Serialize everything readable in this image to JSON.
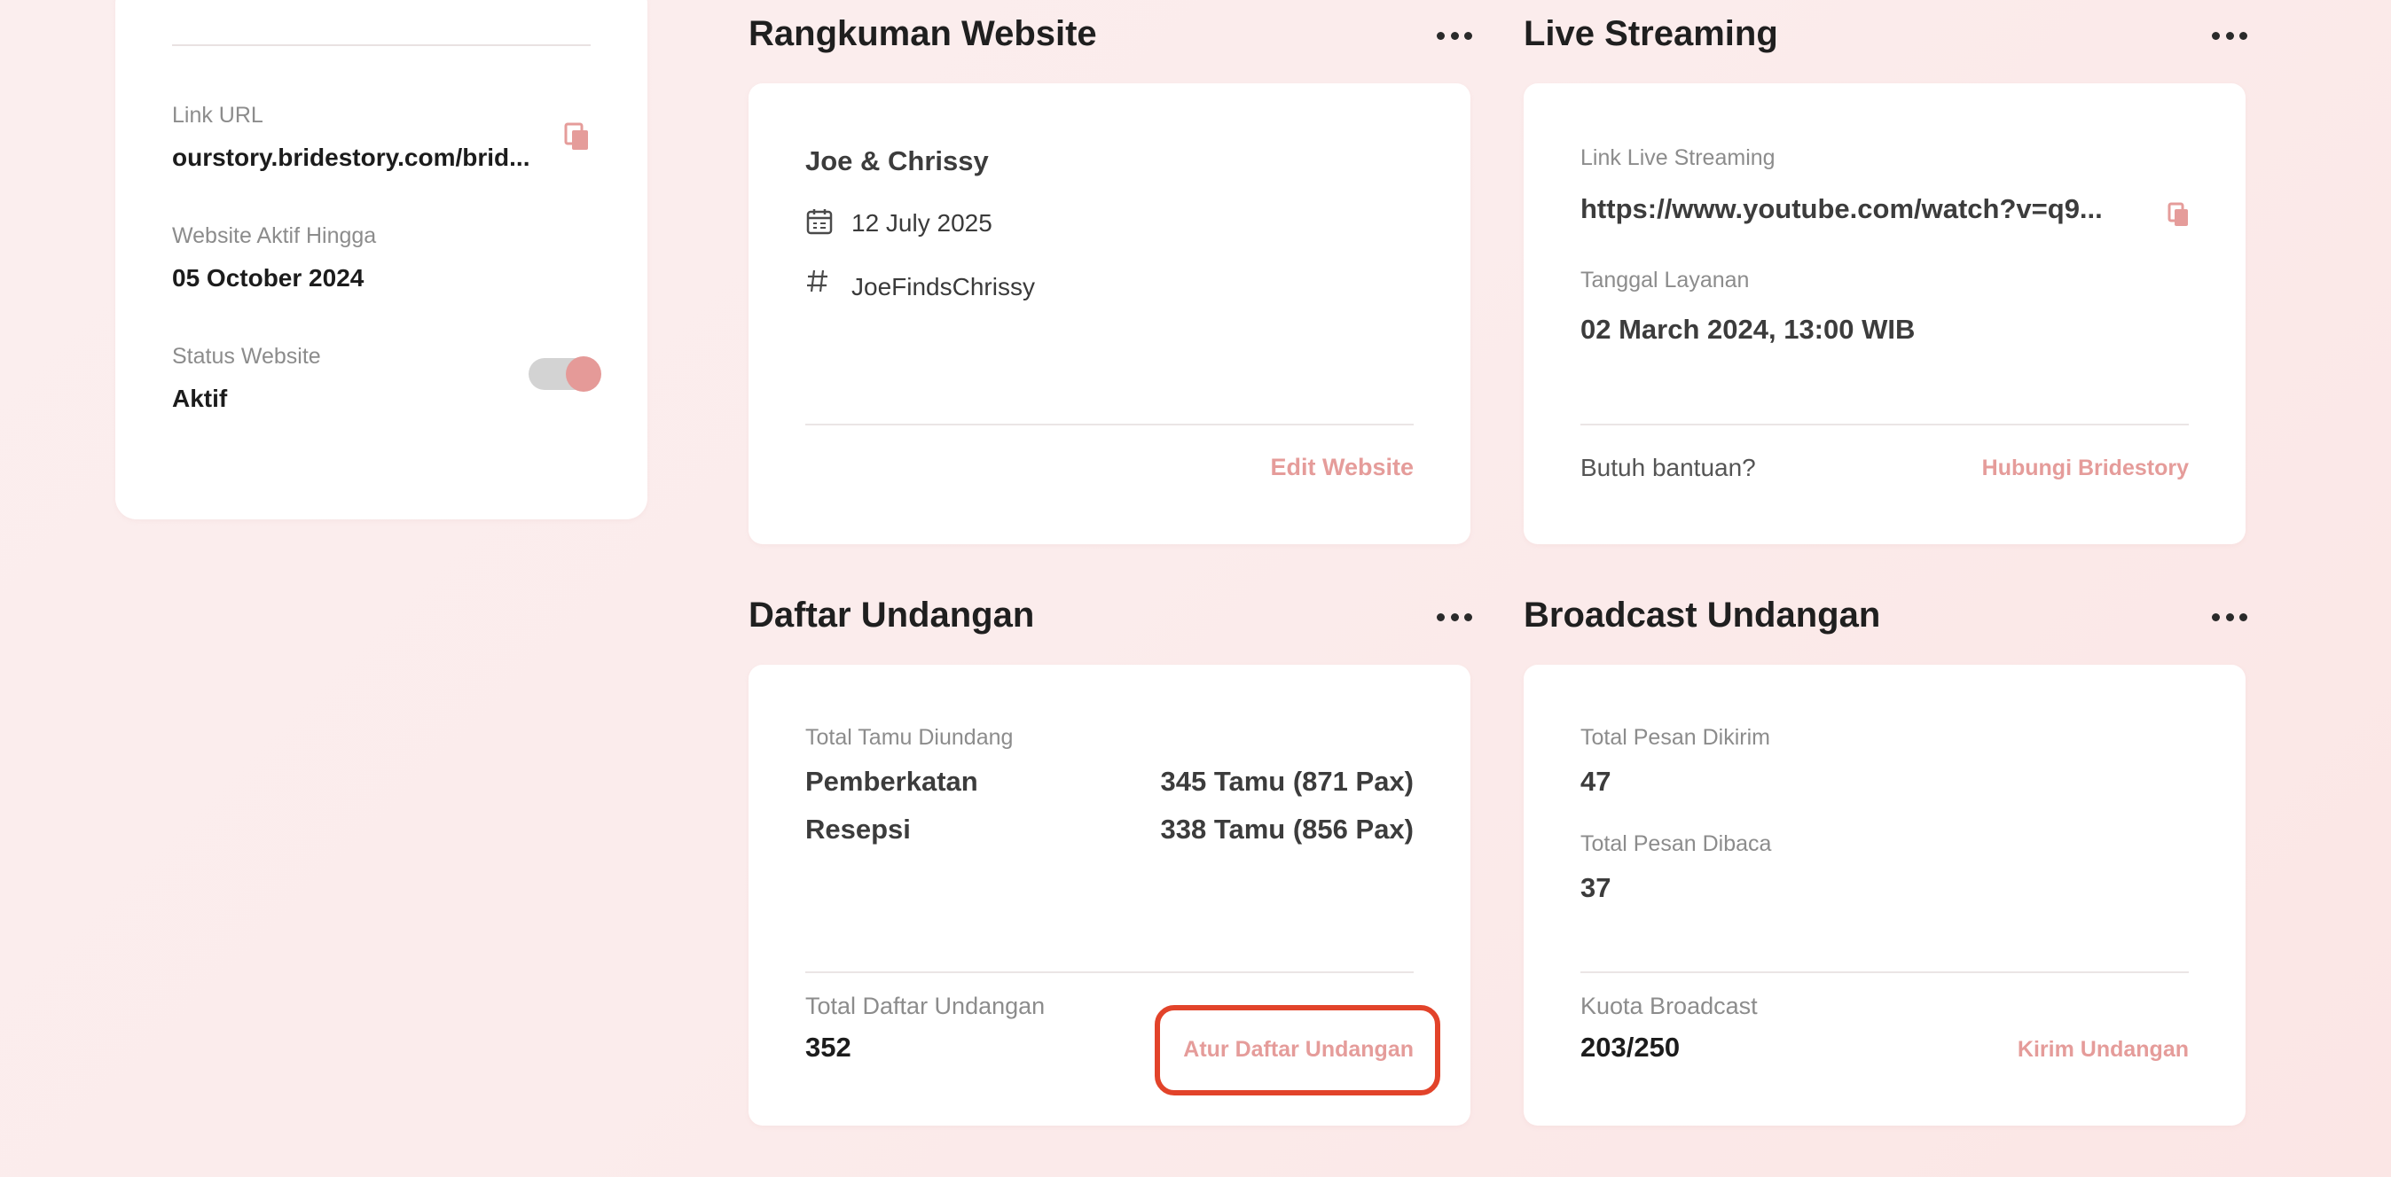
{
  "info": {
    "link_url_label": "Link URL",
    "link_url_value": "ourstory.bridestory.com/brid...",
    "active_until_label": "Website Aktif Hingga",
    "active_until_value": "05 October 2024",
    "status_label": "Status Website",
    "status_value": "Aktif",
    "status_on": true
  },
  "summary": {
    "title": "Rangkuman Website",
    "couple": "Joe & Chrissy",
    "date": "12 July 2025",
    "hashtag": "JoeFindsChrissy",
    "edit_link": "Edit Website"
  },
  "live": {
    "title": "Live Streaming",
    "link_label": "Link Live Streaming",
    "link_value": "https://www.youtube.com/watch?v=q9...",
    "date_label": "Tanggal Layanan",
    "date_value": "02 March 2024, 13:00 WIB",
    "help_text": "Butuh bantuan?",
    "help_link": "Hubungi Bridestory"
  },
  "guests": {
    "title": "Daftar Undangan",
    "total_label": "Total Tamu Diundang",
    "rows": [
      {
        "name": "Pemberkatan",
        "value": "345 Tamu (871 Pax)"
      },
      {
        "name": "Resepsi",
        "value": "338 Tamu (856 Pax)"
      }
    ],
    "list_label": "Total Daftar Undangan",
    "list_value": "352",
    "manage_link": "Atur Daftar Undangan"
  },
  "broadcast": {
    "title": "Broadcast Undangan",
    "sent_label": "Total Pesan Dikirim",
    "sent_value": "47",
    "read_label": "Total Pesan Dibaca",
    "read_value": "37",
    "quota_label": "Kuota Broadcast",
    "quota_value": "203/250",
    "send_link": "Kirim Undangan"
  },
  "colors": {
    "accent": "#e59c9a",
    "highlight": "#e2432a",
    "background": "#fbeeee"
  }
}
